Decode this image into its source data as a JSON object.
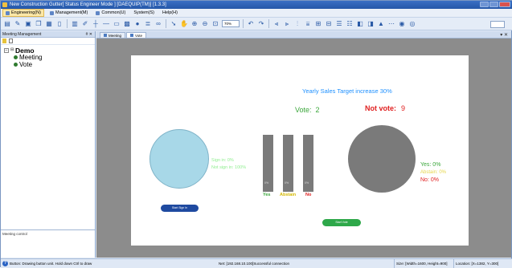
{
  "window": {
    "title": "New Construction Gutter[ Status Engineer Mode ] [DAEQUIP(TM)] [1.3.3]"
  },
  "menu": {
    "items": [
      {
        "label": "Engineering(N)"
      },
      {
        "label": "Management(M)"
      },
      {
        "label": "Common(U)"
      },
      {
        "label": "System(S)"
      },
      {
        "label": "Help(H)"
      }
    ]
  },
  "toolbar": {
    "zoom": "70%"
  },
  "left_panel": {
    "title": "Meeting Management",
    "pin": "# ✕",
    "tree": {
      "root": "Demo",
      "children": [
        {
          "label": "Meeting"
        },
        {
          "label": "Vote"
        }
      ]
    },
    "bottom_label": "Meeting control"
  },
  "doc_tabs": [
    {
      "label": "Meeting"
    },
    {
      "label": "Vote"
    }
  ],
  "slide": {
    "title": "Yearly Sales Target increase 30%",
    "vote_label": "Vote:",
    "vote_count": "2",
    "not_vote_label": "Not vote:",
    "not_vote_count": "9",
    "sign_in": "Sign in:  0%",
    "not_sign_in": "Not sign in:  100%",
    "bars": [
      {
        "label": "Yes",
        "pct": "0%",
        "color": "#3aa63a"
      },
      {
        "label": "Abstain",
        "pct": "0%",
        "color": "#d4b800"
      },
      {
        "label": "No",
        "pct": "0%",
        "color": "#e02020"
      }
    ],
    "result_yes": "Yes:  0%",
    "result_abstain": "Abstain:  0%",
    "result_no": "No:  0%",
    "start_sign_in": "Start Sign In",
    "start_vote": "Start Vote"
  },
  "statusbar": {
    "hint": "Button: Drawing button unit. Hold down Ctrl to draw",
    "connection": "Net: [192.168.10.100]Successful connection",
    "size": "Size: [Width=1600, Height=900]",
    "location": "Location: [X=1382, Y=300]"
  },
  "colors": {
    "vote_green": "#3aa63a",
    "not_vote_red": "#e02020",
    "title_blue": "#1e90ff",
    "sign_circle": "#a8d8e8",
    "result_circle": "#7a7a7a",
    "sign_in_button": "#1f4aa0",
    "vote_button": "#2ea84a"
  }
}
